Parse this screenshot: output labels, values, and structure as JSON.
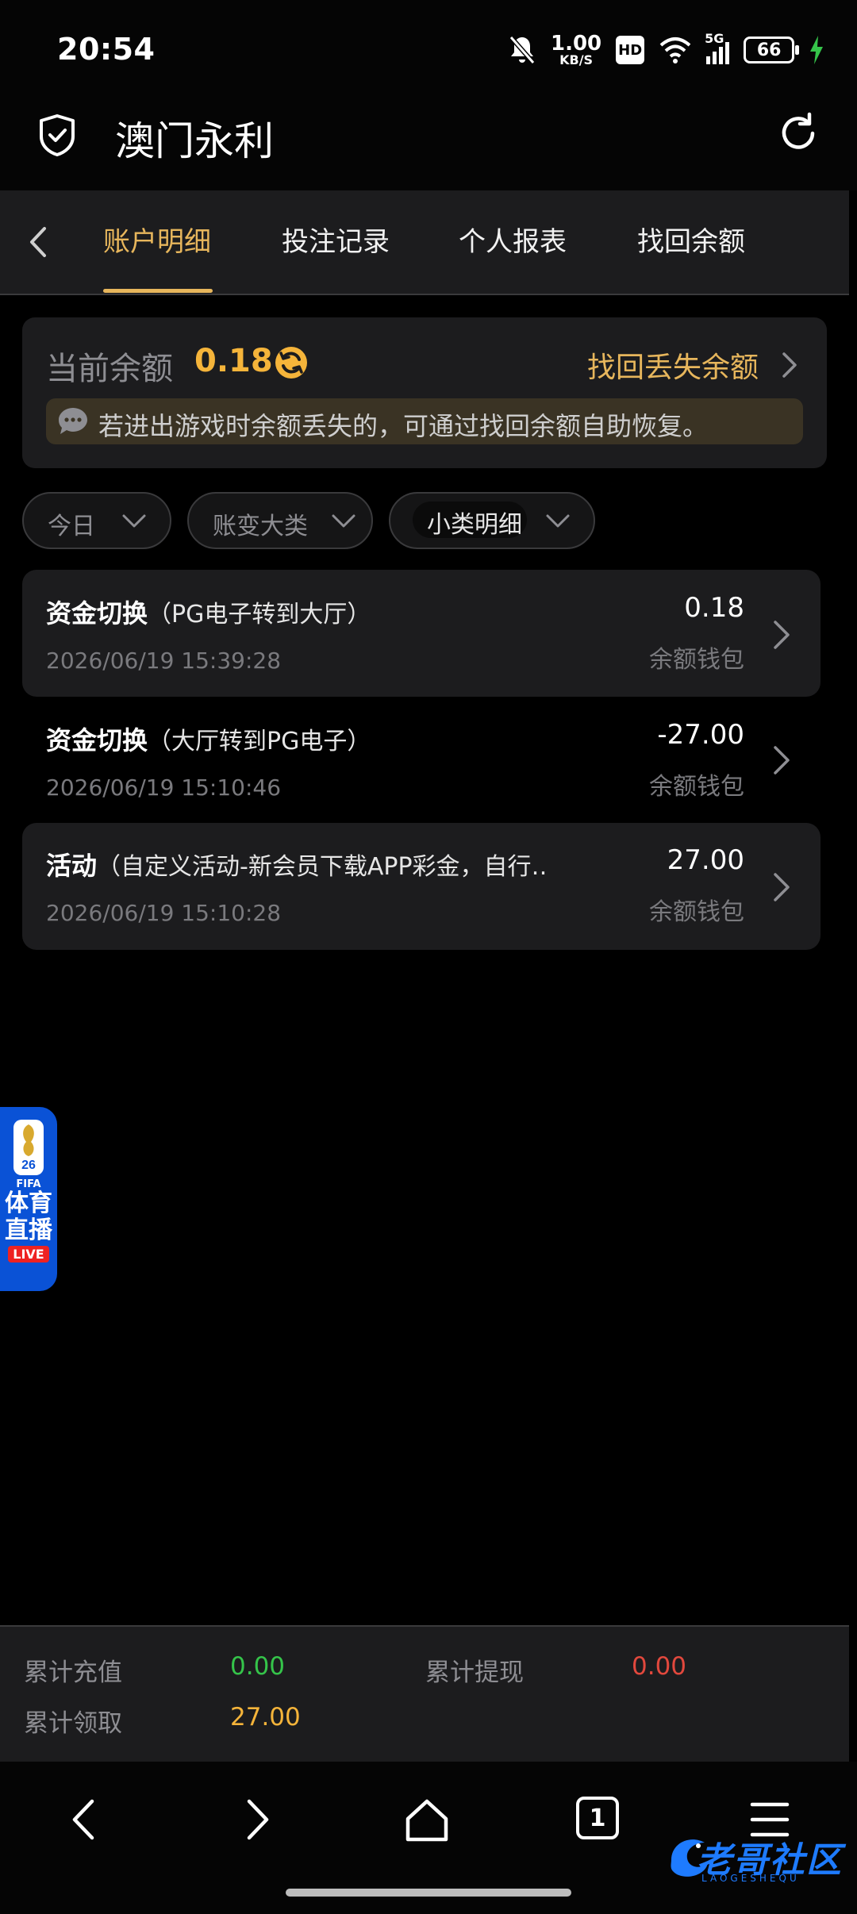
{
  "status_bar": {
    "time": "20:54",
    "net_speed": "1.00",
    "net_unit": "KB/S",
    "hd": "HD",
    "signal": "5G",
    "battery": "66"
  },
  "header": {
    "title": "澳门永利"
  },
  "tabs": [
    {
      "label": "账户明细",
      "active": true
    },
    {
      "label": "投注记录",
      "active": false
    },
    {
      "label": "个人报表",
      "active": false
    },
    {
      "label": "找回余额",
      "active": false
    }
  ],
  "balance": {
    "label": "当前余额",
    "value": "0.18",
    "recover_label": "找回丢失余额",
    "notice": "若进出游戏时余额丢失的，可通过找回余额自助恢复。"
  },
  "filters": [
    {
      "label": "今日"
    },
    {
      "label": "账变大类"
    },
    {
      "label": "小类明细"
    }
  ],
  "records": [
    {
      "type": "资金切换",
      "detail": "（PG电子转到大厅）",
      "time": "2026/06/19 15:39:28",
      "amount": "0.18",
      "wallet": "余额钱包"
    },
    {
      "type": "资金切换",
      "detail": "（大厅转到PG电子）",
      "time": "2026/06/19 15:10:46",
      "amount": "-27.00",
      "wallet": "余额钱包"
    },
    {
      "type": "活动",
      "detail": "（自定义活动-新会员下载APP彩金，自行…",
      "time": "2026/06/19 15:10:28",
      "amount": "27.00",
      "wallet": "余额钱包"
    }
  ],
  "float_widget": {
    "year": "26",
    "fifa": "FIFA",
    "line1": "体育",
    "line2": "直播",
    "live": "LIVE"
  },
  "summary": {
    "recharge_label": "累计充值",
    "recharge_value": "0.00",
    "withdraw_label": "累计提现",
    "withdraw_value": "0.00",
    "claim_label": "累计领取",
    "claim_value": "27.00"
  },
  "browser_nav": {
    "tab_count": "1"
  },
  "watermark": {
    "text": "老哥社区",
    "sub": "LAOGESHEQU"
  },
  "colors": {
    "accent_gold": "#e7b65c",
    "balance_orange": "#f5b43a",
    "recharge_green": "#35c44a",
    "withdraw_red": "#e2483d",
    "claim_orange": "#f5b43a"
  }
}
